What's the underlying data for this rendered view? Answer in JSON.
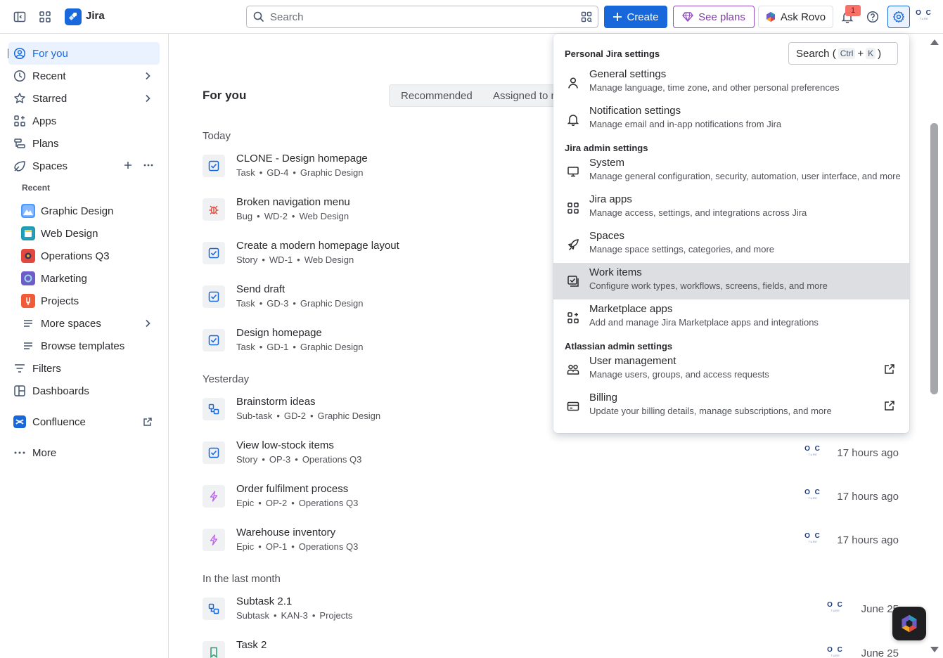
{
  "app": {
    "name": "Jira"
  },
  "header": {
    "search_placeholder": "Search",
    "create_label": "Create",
    "plans_label": "See plans",
    "rovo_label": "Ask Rovo",
    "notification_count": "1",
    "avatar_initials": "O C",
    "avatar_sub": "TURE"
  },
  "sidebar": {
    "items": [
      {
        "label": "For you"
      },
      {
        "label": "Recent"
      },
      {
        "label": "Starred"
      },
      {
        "label": "Apps"
      },
      {
        "label": "Plans"
      },
      {
        "label": "Spaces"
      }
    ],
    "recent_label": "Recent",
    "spaces": [
      {
        "label": "Graphic Design",
        "color": "#4c9aff"
      },
      {
        "label": "Web Design",
        "color": "#1d7afc"
      },
      {
        "label": "Operations Q3",
        "color": "#e2483d"
      },
      {
        "label": "Marketing",
        "color": "#6e5dc6"
      },
      {
        "label": "Projects",
        "color": "#f15b38"
      }
    ],
    "more_spaces": "More spaces",
    "browse_templates": "Browse templates",
    "filters": "Filters",
    "dashboards": "Dashboards",
    "confluence": "Confluence",
    "more": "More"
  },
  "main": {
    "title": "For you",
    "tabs": [
      "Recommended",
      "Assigned to me"
    ],
    "groups": [
      {
        "label": "Today"
      },
      {
        "label": "Yesterday"
      },
      {
        "label": "In the last month"
      }
    ],
    "items": [
      {
        "title": "CLONE - Design homepage",
        "type": "Task",
        "key": "GD-4",
        "space": "Graphic Design",
        "when": ""
      },
      {
        "title": "Broken navigation menu",
        "type": "Bug",
        "key": "WD-2",
        "space": "Web Design",
        "when": ""
      },
      {
        "title": "Create a modern homepage layout",
        "type": "Story",
        "key": "WD-1",
        "space": "Web Design",
        "when": ""
      },
      {
        "title": "Send draft",
        "type": "Task",
        "key": "GD-3",
        "space": "Graphic Design",
        "when": ""
      },
      {
        "title": "Design homepage",
        "type": "Task",
        "key": "GD-1",
        "space": "Graphic Design",
        "when": ""
      },
      {
        "title": "Brainstorm ideas",
        "type": "Sub-task",
        "key": "GD-2",
        "space": "Graphic Design",
        "when": ""
      },
      {
        "title": "View low-stock items",
        "type": "Story",
        "key": "OP-3",
        "space": "Operations Q3",
        "when": "17 hours ago"
      },
      {
        "title": "Order fulfilment process",
        "type": "Epic",
        "key": "OP-2",
        "space": "Operations Q3",
        "when": "17 hours ago"
      },
      {
        "title": "Warehouse inventory",
        "type": "Epic",
        "key": "OP-1",
        "space": "Operations Q3",
        "when": "17 hours ago"
      },
      {
        "title": "Subtask 2.1",
        "type": "Subtask",
        "key": "KAN-3",
        "space": "Projects",
        "when": "June 25"
      },
      {
        "title": "Task 2",
        "type": "",
        "key": "",
        "space": "",
        "when": "June 25"
      }
    ]
  },
  "settings_menu": {
    "search_label": "Search (",
    "search_key1": "Ctrl",
    "search_plus": "+",
    "search_key2": "K",
    "search_close": ")",
    "sections": [
      {
        "label": "Personal Jira settings"
      },
      {
        "label": "Jira admin settings"
      },
      {
        "label": "Atlassian admin settings"
      }
    ],
    "items": [
      {
        "title": "General settings",
        "desc": "Manage language, time zone, and other personal preferences",
        "icon": "person-icon"
      },
      {
        "title": "Notification settings",
        "desc": "Manage email and in-app notifications from Jira",
        "icon": "bell-icon"
      },
      {
        "title": "System",
        "desc": "Manage general configuration, security, automation, user interface, and more",
        "icon": "monitor-icon"
      },
      {
        "title": "Jira apps",
        "desc": "Manage access, settings, and integrations across Jira",
        "icon": "apps-grid-icon"
      },
      {
        "title": "Spaces",
        "desc": "Manage space settings, categories, and more",
        "icon": "rocket-icon"
      },
      {
        "title": "Work items",
        "desc": "Configure work types, workflows, screens, fields, and more",
        "icon": "work-items-icon"
      },
      {
        "title": "Marketplace apps",
        "desc": "Add and manage Jira Marketplace apps and integrations",
        "icon": "marketplace-icon"
      },
      {
        "title": "User management",
        "desc": "Manage users, groups, and access requests",
        "icon": "people-icon"
      },
      {
        "title": "Billing",
        "desc": "Update your billing details, manage subscriptions, and more",
        "icon": "credit-card-icon"
      }
    ]
  },
  "colors": {
    "brand": "#1868db",
    "task": "#1868db",
    "bug": "#e2483d",
    "story": "#1868db",
    "epic": "#bf63f3",
    "subtask": "#1868db",
    "hover_row": "#dddee1"
  }
}
